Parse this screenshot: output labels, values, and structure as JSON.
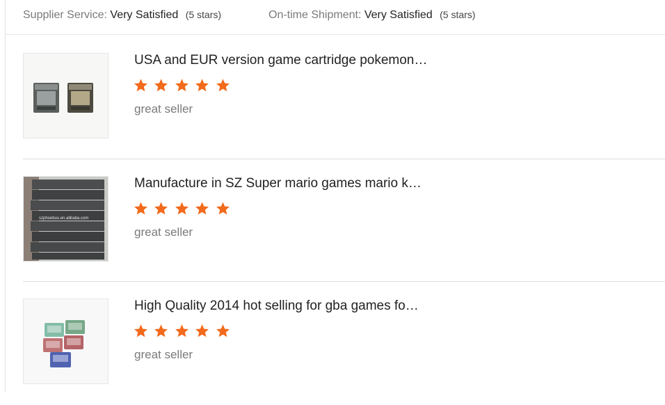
{
  "summary": {
    "supplier_service": {
      "label": "Supplier Service:",
      "value": "Very Satisfied",
      "stars_text": "(5 stars)"
    },
    "ontime_shipment": {
      "label": "On-time Shipment:",
      "value": "Very Satisfied",
      "stars_text": "(5 stars)"
    }
  },
  "colors": {
    "star": "#f26a1b",
    "divider": "#dcdcdc"
  },
  "reviews": [
    {
      "title": "USA and EUR version game cartridge pokemon…",
      "rating": 5,
      "comment": "great seller",
      "thumbnail_icon": "ds-cartridges-thumbnail"
    },
    {
      "title": "Manufacture in SZ Super mario games mario k…",
      "rating": 5,
      "comment": "great seller",
      "thumbnail_icon": "game-cases-stack-thumbnail",
      "thumbnail_watermark": "szphoebus.en.alibaba.com"
    },
    {
      "title": "High Quality 2014 hot selling for gba games fo…",
      "rating": 5,
      "comment": "great seller",
      "thumbnail_icon": "gba-cartridges-thumbnail"
    }
  ]
}
